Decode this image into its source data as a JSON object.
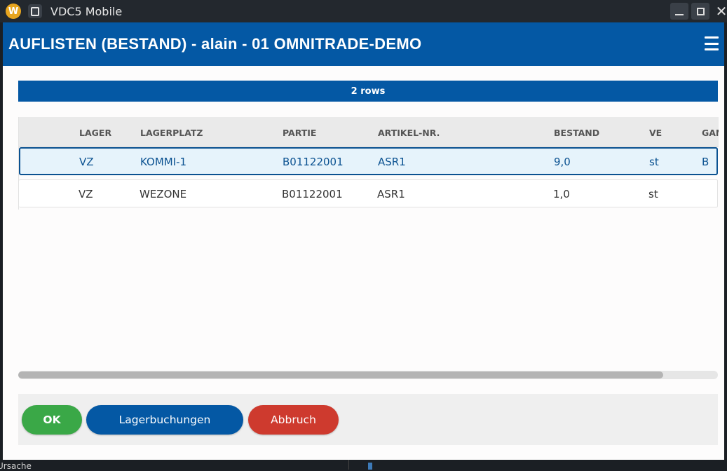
{
  "os_window": {
    "title": "VDC5 Mobile"
  },
  "app": {
    "title": "AUFLISTEN (BESTAND) - alain - 01 OMNITRADE-DEMO",
    "row_count_label": "2 rows"
  },
  "table": {
    "columns": [
      "LAGER",
      "LAGERPLATZ",
      "PARTIE",
      "ARTIKEL-NR.",
      "BESTAND",
      "VE",
      "GAN"
    ],
    "rows": [
      [
        "VZ",
        "KOMMI-1",
        "B01122001",
        "ASR1",
        "9,0",
        "st",
        "B"
      ],
      [
        "VZ",
        "WEZONE",
        "B01122001",
        "ASR1",
        "1,0",
        "st",
        ""
      ]
    ],
    "selected_row": 0
  },
  "footer": {
    "ok_label": "OK",
    "lagerbuchungen_label": "Lagerbuchungen",
    "abbruch_label": "Abbruch"
  },
  "background": {
    "text_left": "Ursache"
  },
  "colors": {
    "header_blue": "#0458a4",
    "ok_green": "#3aa847",
    "cancel_red": "#ce3a2e",
    "selected_row_bg": "#e6f3fb"
  },
  "icons": {
    "app_logo": "w-logo-icon",
    "pin": "pin-icon",
    "minimize": "minimize-icon",
    "maximize": "maximize-icon",
    "close": "close-icon",
    "menu": "hamburger-menu-icon"
  }
}
